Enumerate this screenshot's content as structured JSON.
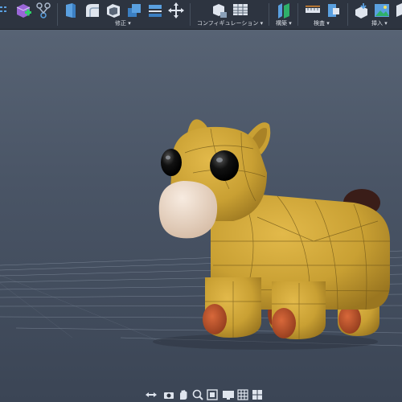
{
  "toolbar": {
    "groups": {
      "modify": "修正 ▾",
      "configure": "コンフィギュレーション ▾",
      "construct": "構築 ▾",
      "inspect": "検査 ▾",
      "insert": "挿入 ▾"
    }
  },
  "icons": {
    "left_partial": "grid-icon",
    "create_form": "create-form-icon",
    "branch": "branch-icon",
    "press_pull": "press-pull-icon",
    "fillet": "fillet-icon",
    "shell": "shell-icon",
    "combine": "combine-icon",
    "align": "align-icon",
    "move": "move-icon",
    "config_component": "config-component-icon",
    "config_table": "config-table-icon",
    "offset_plane": "offset-plane-icon",
    "measure": "measure-icon",
    "section": "section-analysis-icon",
    "insert_derive": "insert-derive-icon",
    "insert_image": "insert-image-icon"
  },
  "model": {
    "body_color": "#c9a033",
    "muzzle_color": "#ead4c1",
    "hoof_color": "#c0532a",
    "tail_color": "#3a1d18",
    "eye_color": "#0b0b0b"
  },
  "navbar": {
    "icons": [
      "orbit-icon",
      "look-at-icon",
      "pan-icon",
      "zoom-icon",
      "fit-icon",
      "display-settings-icon",
      "grid-settings-icon",
      "viewports-icon"
    ]
  }
}
